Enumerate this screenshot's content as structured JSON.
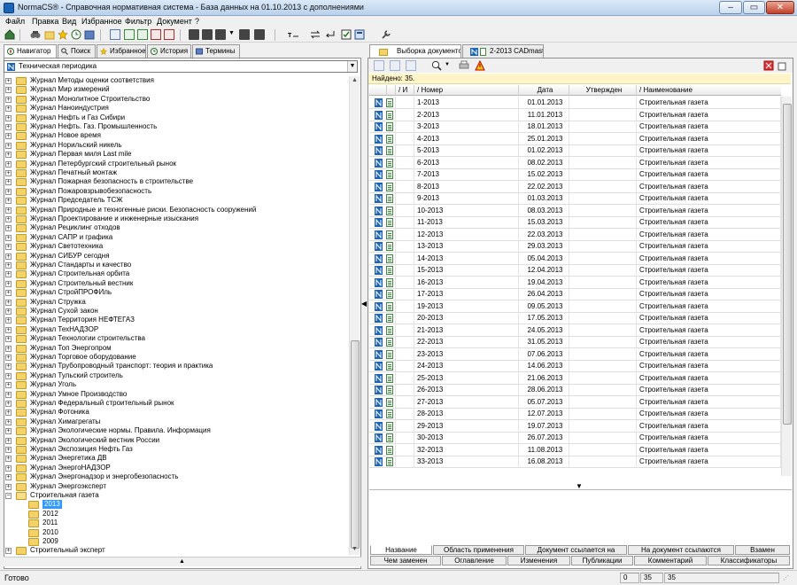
{
  "window": {
    "title": "NormaCS® - Справочная нормативная система - База данных на 01.10.2013 с дополнениями",
    "minimize": "‒",
    "maximize": "▭",
    "close": "✕"
  },
  "menu": [
    "Файл",
    "Правка",
    "Вид",
    "Избранное",
    "Фильтр",
    "Документ",
    "?"
  ],
  "left_tabs": [
    {
      "label": "Навигатор",
      "icon": "compass-icon"
    },
    {
      "label": "Поиск",
      "icon": "magnifier-icon"
    },
    {
      "label": "Избранное",
      "icon": "star-icon"
    },
    {
      "label": "История",
      "icon": "clock-icon"
    },
    {
      "label": "Термины",
      "icon": "book-icon"
    }
  ],
  "left_combo": {
    "value": "Техническая периодика",
    "arrow": "▼"
  },
  "tree": {
    "items": [
      "Журнал Методы оценки соответствия",
      "Журнал Мир измерений",
      "Журнал Монолитное Строительство",
      "Журнал Наноиндустрия",
      "Журнал Нефть и Газ Сибири",
      "Журнал Нефть. Газ. Промышленность",
      "Журнал Новое время",
      "Журнал Норильский никель",
      "Журнал Первая миля Last mile",
      "Журнал Петербургский строительный рынок",
      "Журнал Печатный монтаж",
      "Журнал Пожарная безопасность в строительстве",
      "Журнал Пожаровзрывобезопасность",
      "Журнал Председатель ТСЖ",
      "Журнал Природные и техногенные риски. Безопасность сооружений",
      "Журнал Проектирование и инженерные изыскания",
      "Журнал Рециклинг отходов",
      "Журнал САПР и графика",
      "Журнал Светотехника",
      "Журнал СИБУР сегодня",
      "Журнал Стандарты и качество",
      "Журнал Строительная орбита",
      "Журнал Строительный вестник",
      "Журнал СтройПРОФИль",
      "Журнал Стружка",
      "Журнал Сухой закон",
      "Журнал Территория НЕФТЕГАЗ",
      "Журнал ТехНАДЗОР",
      "Журнал Технологии строительства",
      "Журнал Топ Энергопром",
      "Журнал Торговое оборудование",
      "Журнал Трубопроводный транспорт: теория и практика",
      "Журнал Тульский строитель",
      "Журнал Уголь",
      "Журнал Умное Производство",
      "Журнал Федеральный строительный рынок",
      "Журнал Фотоника",
      "Журнал Химагрегаты",
      "Журнал Экологические нормы. Правила. Информация",
      "Журнал Экологический вестник России",
      "Журнал Экспозиция Нефть Газ",
      "Журнал Энергетика ДВ",
      "Журнал ЭнергоНАДЗОР",
      "Журнал Энергонадзор и энергобезопасность",
      "Журнал Энергоэксперт"
    ],
    "open_item": "Строительная газета",
    "years": [
      "2013",
      "2012",
      "2011",
      "2010",
      "2009"
    ],
    "selected_year": "2013",
    "last_item": "Строительный эксперт",
    "expand_symbol": "+",
    "collapse_symbol": "−"
  },
  "right_tabs": [
    {
      "label": "Выборка документов"
    },
    {
      "label": "2-2013 CADmaste..."
    }
  ],
  "found_label": "Найдено: 35.",
  "grid": {
    "headers": [
      "И",
      "Номер",
      "Дата",
      "Утвержден",
      "Наименование"
    ],
    "sort_mark": "/",
    "rows": [
      {
        "num": "1-2013",
        "date": "01.01.2013",
        "name": "Строительная газета"
      },
      {
        "num": "2-2013",
        "date": "11.01.2013",
        "name": "Строительная газета"
      },
      {
        "num": "3-2013",
        "date": "18.01.2013",
        "name": "Строительная газета"
      },
      {
        "num": "4-2013",
        "date": "25.01.2013",
        "name": "Строительная газета"
      },
      {
        "num": "5-2013",
        "date": "01.02.2013",
        "name": "Строительная газета"
      },
      {
        "num": "6-2013",
        "date": "08.02.2013",
        "name": "Строительная газета"
      },
      {
        "num": "7-2013",
        "date": "15.02.2013",
        "name": "Строительная газета"
      },
      {
        "num": "8-2013",
        "date": "22.02.2013",
        "name": "Строительная газета"
      },
      {
        "num": "9-2013",
        "date": "01.03.2013",
        "name": "Строительная газета"
      },
      {
        "num": "10-2013",
        "date": "08.03.2013",
        "name": "Строительная газета"
      },
      {
        "num": "11-2013",
        "date": "15.03.2013",
        "name": "Строительная газета"
      },
      {
        "num": "12-2013",
        "date": "22.03.2013",
        "name": "Строительная газета"
      },
      {
        "num": "13-2013",
        "date": "29.03.2013",
        "name": "Строительная газета"
      },
      {
        "num": "14-2013",
        "date": "05.04.2013",
        "name": "Строительная газета"
      },
      {
        "num": "15-2013",
        "date": "12.04.2013",
        "name": "Строительная газета"
      },
      {
        "num": "16-2013",
        "date": "19.04.2013",
        "name": "Строительная газета"
      },
      {
        "num": "17-2013",
        "date": "26.04.2013",
        "name": "Строительная газета"
      },
      {
        "num": "19-2013",
        "date": "09.05.2013",
        "name": "Строительная газета"
      },
      {
        "num": "20-2013",
        "date": "17.05.2013",
        "name": "Строительная газета"
      },
      {
        "num": "21-2013",
        "date": "24.05.2013",
        "name": "Строительная газета"
      },
      {
        "num": "22-2013",
        "date": "31.05.2013",
        "name": "Строительная газета"
      },
      {
        "num": "23-2013",
        "date": "07.06.2013",
        "name": "Строительная газета"
      },
      {
        "num": "24-2013",
        "date": "14.06.2013",
        "name": "Строительная газета"
      },
      {
        "num": "25-2013",
        "date": "21.06.2013",
        "name": "Строительная газета"
      },
      {
        "num": "26-2013",
        "date": "28.06.2013",
        "name": "Строительная газета"
      },
      {
        "num": "27-2013",
        "date": "05.07.2013",
        "name": "Строительная газета"
      },
      {
        "num": "28-2013",
        "date": "12.07.2013",
        "name": "Строительная газета"
      },
      {
        "num": "29-2013",
        "date": "19.07.2013",
        "name": "Строительная газета"
      },
      {
        "num": "30-2013",
        "date": "26.07.2013",
        "name": "Строительная газета"
      },
      {
        "num": "32-2013",
        "date": "11.08.2013",
        "name": "Строительная газета"
      },
      {
        "num": "33-2013",
        "date": "16.08.2013",
        "name": "Строительная газета"
      }
    ]
  },
  "bottom_tabs_row1": [
    "Название",
    "Область применения",
    "Документ ссылается на",
    "На документ ссылаются",
    "Взамен"
  ],
  "bottom_tabs_row2": [
    "Чем заменен",
    "Оглавление",
    "Изменения",
    "Публикации",
    "Комментарий",
    "Классификаторы"
  ],
  "status": {
    "text": "Готово",
    "cells": [
      "0",
      "35",
      "35"
    ]
  },
  "arrows": {
    "up": "▲",
    "down": "▼",
    "left": "◀"
  },
  "colors": {
    "selection": "#3399ff",
    "found_bar": "#fdf5c8",
    "folder": "#f3d26a",
    "doc_green": "#3d8a3d",
    "doc_blue": "#1e64b4"
  }
}
